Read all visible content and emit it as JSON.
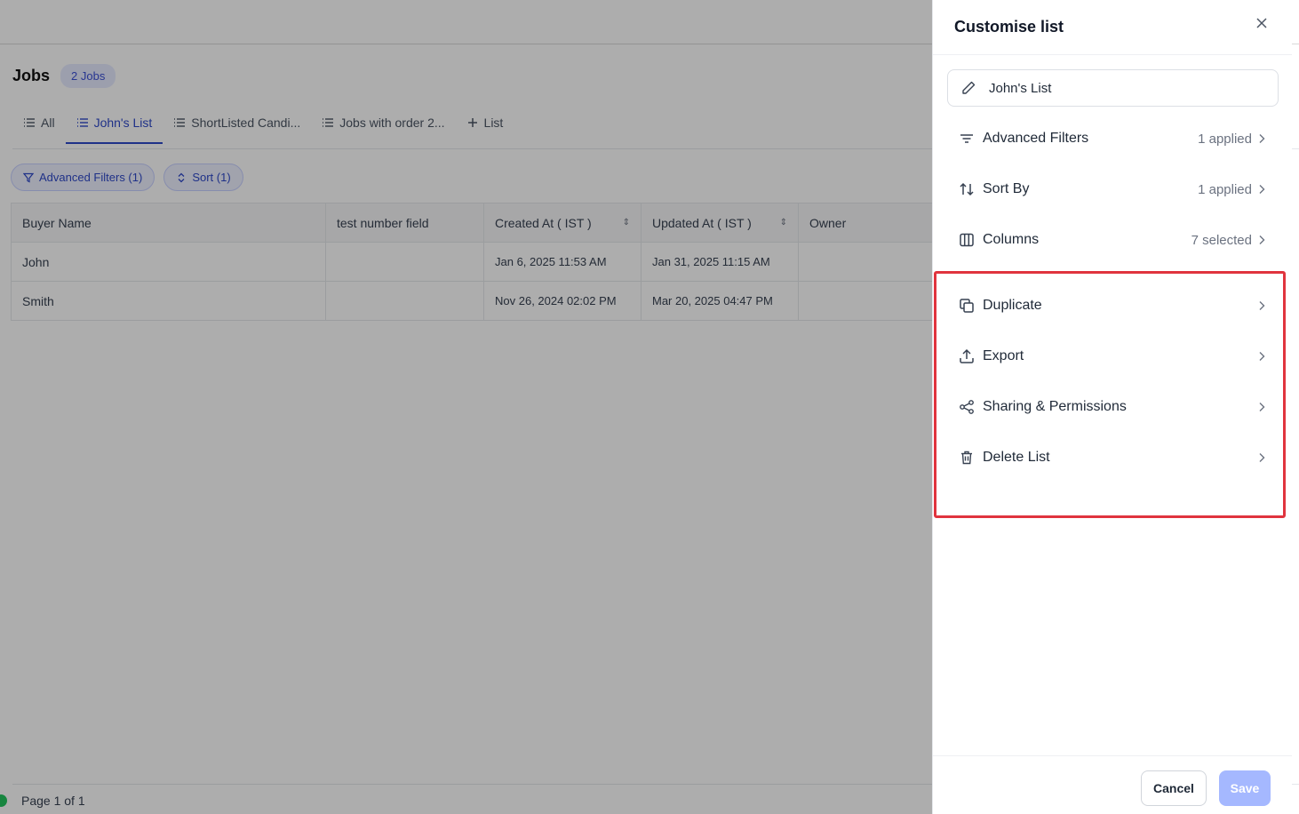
{
  "page": {
    "title": "Jobs",
    "count_badge": "2 Jobs"
  },
  "tabs": [
    {
      "label": "All",
      "icon": "list-icon",
      "active": false
    },
    {
      "label": "John's List",
      "icon": "list-icon",
      "active": true
    },
    {
      "label": "ShortListed Candi...",
      "icon": "list-icon",
      "active": false
    },
    {
      "label": "Jobs with order 2...",
      "icon": "list-icon",
      "active": false
    },
    {
      "label": "List",
      "icon": "plus-icon",
      "active": false
    }
  ],
  "filters": {
    "advanced": "Advanced Filters (1)",
    "sort": "Sort (1)"
  },
  "table": {
    "columns": [
      "Buyer Name",
      "test number field",
      "Created At ( IST )",
      "Updated At ( IST )",
      "Owner"
    ],
    "rows": [
      [
        "John",
        "",
        "Jan 6, 2025 11:53 AM",
        "Jan 31, 2025 11:15 AM",
        ""
      ],
      [
        "Smith",
        "",
        "Nov 26, 2024 02:02 PM",
        "Mar 20, 2025 04:47 PM",
        ""
      ]
    ]
  },
  "pager": {
    "text": "Page 1 of 1"
  },
  "panel": {
    "title": "Customise list",
    "list_name": "John's List",
    "options": [
      {
        "label": "Advanced Filters",
        "value": "1 applied",
        "icon": "filter-lines-icon"
      },
      {
        "label": "Sort By",
        "value": "1 applied",
        "icon": "sort-arrows-icon"
      },
      {
        "label": "Columns",
        "value": "7 selected",
        "icon": "columns-icon"
      },
      {
        "label": "Duplicate",
        "value": "",
        "icon": "duplicate-icon"
      },
      {
        "label": "Export",
        "value": "",
        "icon": "export-icon"
      },
      {
        "label": "Sharing & Permissions",
        "value": "",
        "icon": "share-icon"
      },
      {
        "label": "Delete List",
        "value": "",
        "icon": "trash-icon"
      }
    ],
    "cancel": "Cancel",
    "save": "Save"
  },
  "colors": {
    "accent": "#2f49c9",
    "highlight": "#e0343e",
    "save_disabled": "#a5b8ff"
  }
}
